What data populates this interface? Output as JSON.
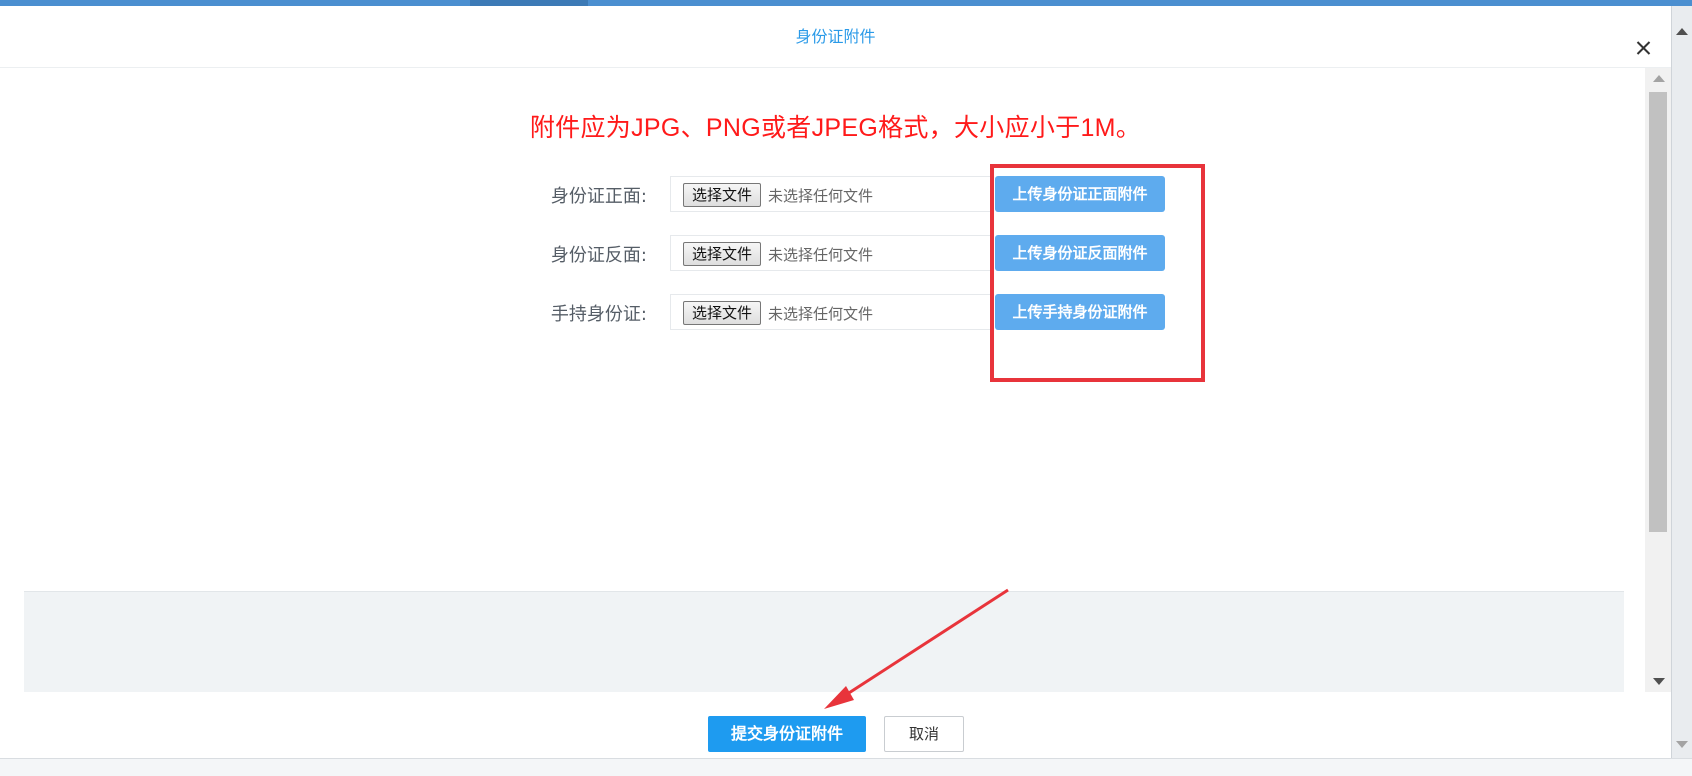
{
  "modal": {
    "title": "身份证附件",
    "close_icon": "close-icon"
  },
  "notice": "附件应为JPG、PNG或者JPEG格式，大小应小于1M。",
  "rows": [
    {
      "label": "身份证正面:",
      "choose_label": "选择文件",
      "status": "未选择任何文件",
      "upload_label": "上传身份证正面附件"
    },
    {
      "label": "身份证反面:",
      "choose_label": "选择文件",
      "status": "未选择任何文件",
      "upload_label": "上传身份证反面附件"
    },
    {
      "label": "手持身份证:",
      "choose_label": "选择文件",
      "status": "未选择任何文件",
      "upload_label": "上传手持身份证附件"
    }
  ],
  "footer": {
    "submit_label": "提交身份证附件",
    "cancel_label": "取消"
  },
  "colors": {
    "accent": "#1e9bf0",
    "upload_button": "#5eabee",
    "notice_text": "#ff1a1a",
    "highlight": "#e8343b"
  }
}
